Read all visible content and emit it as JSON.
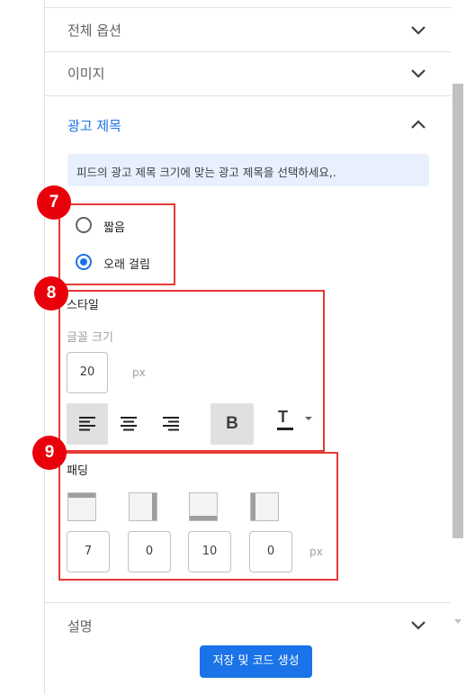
{
  "sections": {
    "all_options": "전체 옵션",
    "image": "이미지",
    "ad_title": "광고 제목",
    "description": "설명"
  },
  "info_text": "피드의 광고 제목 크기에 맞는 광고 제목을 선택하세요,.",
  "title_length": {
    "options": [
      {
        "label": "짧음",
        "checked": false
      },
      {
        "label": "오래 걸림",
        "checked": true
      }
    ]
  },
  "badges": {
    "b7": "7",
    "b8": "8",
    "b9": "9"
  },
  "style": {
    "title": "스타일",
    "font_size_label": "글꼴 크기",
    "font_size_value": "20",
    "font_size_unit": "px",
    "alignment_active": "left",
    "bold_label": "B",
    "bold_active": true,
    "text_color_label": "T"
  },
  "padding": {
    "title": "패딩",
    "values": [
      "7",
      "0",
      "10",
      "0"
    ],
    "unit": "px"
  },
  "save_button": "저장 및 코드 생성",
  "colors": {
    "accent": "#1a73e8",
    "annotation": "#e53935"
  }
}
